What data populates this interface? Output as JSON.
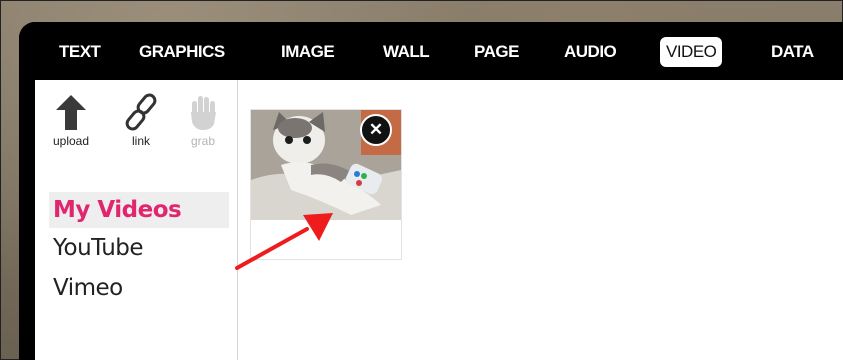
{
  "tabs": [
    {
      "label": "TEXT"
    },
    {
      "label": "GRAPHICS"
    },
    {
      "label": "IMAGE"
    },
    {
      "label": "WALL"
    },
    {
      "label": "PAGE"
    },
    {
      "label": "AUDIO"
    },
    {
      "label": "VIDEO",
      "active": true
    },
    {
      "label": "DATA"
    }
  ],
  "tools": [
    {
      "label": "upload",
      "icon": "upload-arrow-icon"
    },
    {
      "label": "link",
      "icon": "chain-link-icon"
    },
    {
      "label": "grab",
      "icon": "hand-icon",
      "disabled": true
    }
  ],
  "sources": [
    {
      "label": "My Videos",
      "active": true
    },
    {
      "label": "YouTube"
    },
    {
      "label": "Vimeo"
    }
  ],
  "videos": [
    {
      "thumbnail": "cat-with-game-controller",
      "remove_icon": "close-icon"
    }
  ],
  "annotation": {
    "type": "red-arrow",
    "color": "#ee1c1c"
  },
  "colors": {
    "accent": "#e0266f",
    "topbar": "#000000"
  }
}
